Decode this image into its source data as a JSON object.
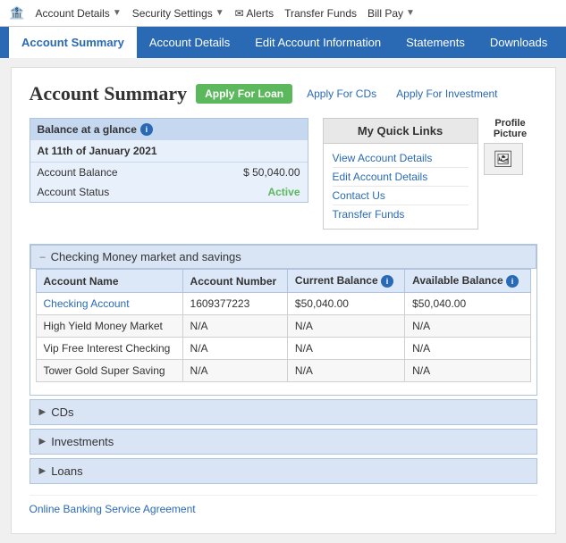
{
  "topNav": {
    "icon": "🏦",
    "items": [
      {
        "label": "Account Details",
        "hasArrow": true
      },
      {
        "label": "Security Settings",
        "hasArrow": true
      },
      {
        "label": "✉ Alerts",
        "hasArrow": false
      },
      {
        "label": "Transfer Funds",
        "hasArrow": false
      },
      {
        "label": "Bill Pay",
        "hasArrow": true
      }
    ]
  },
  "blueNav": {
    "items": [
      {
        "label": "Account Summary",
        "active": true
      },
      {
        "label": "Account Details",
        "active": false
      },
      {
        "label": "Edit Account Information",
        "active": false
      },
      {
        "label": "Statements",
        "active": false
      },
      {
        "label": "Downloads",
        "active": false
      }
    ]
  },
  "pageTitle": "Account Summary",
  "applyButtons": {
    "loan": "Apply For Loan",
    "cds": "Apply For CDs",
    "investment": "Apply For Investment"
  },
  "balanceAtGlance": {
    "header": "Balance at a glance",
    "date": "At 11th of January 2021",
    "rows": [
      {
        "label": "Account Balance",
        "value": "$ 50,040.00"
      },
      {
        "label": "Account Status",
        "value": "Active",
        "isStatus": true
      }
    ]
  },
  "quickLinks": {
    "header": "My Quick Links",
    "links": [
      "View Account Details",
      "Edit Account Details",
      "Contact Us",
      "Transfer Funds"
    ]
  },
  "profileSection": {
    "label": "Profile Picture"
  },
  "checkingSection": {
    "title": "Checking Money market and savings",
    "tableHeaders": [
      "Account Name",
      "Account Number",
      "Current Balance",
      "Available Balance"
    ],
    "rows": [
      {
        "name": "Checking Account",
        "number": "1609377223",
        "current": "$50,040.00",
        "available": "$50,040.00",
        "isLink": true
      },
      {
        "name": "High Yield Money Market",
        "number": "N/A",
        "current": "N/A",
        "available": "N/A",
        "isLink": false
      },
      {
        "name": "Vip Free Interest Checking",
        "number": "N/A",
        "current": "N/A",
        "available": "N/A",
        "isLink": false
      },
      {
        "name": "Tower Gold Super Saving",
        "number": "N/A",
        "current": "N/A",
        "available": "N/A",
        "isLink": false
      }
    ]
  },
  "collapsibleSections": [
    {
      "label": "CDs"
    },
    {
      "label": "Investments"
    },
    {
      "label": "Loans"
    }
  ],
  "footer": {
    "link": "Online Banking Service Agreement"
  }
}
